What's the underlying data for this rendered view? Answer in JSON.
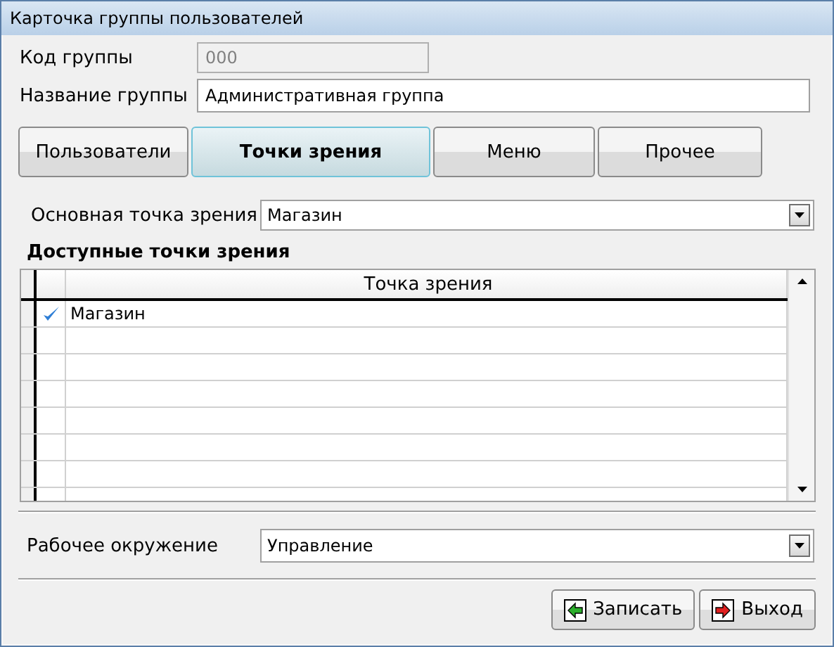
{
  "window": {
    "title": "Карточка группы пользователей"
  },
  "group_code": {
    "label": "Код группы",
    "value": "000",
    "disabled": true
  },
  "group_name": {
    "label": "Название группы",
    "value": "Административная группа"
  },
  "tabs": [
    {
      "label": "Пользователи",
      "selected": false
    },
    {
      "label": "Точки зрения",
      "selected": true
    },
    {
      "label": "Меню",
      "selected": false
    },
    {
      "label": "Прочее",
      "selected": false
    }
  ],
  "main_view": {
    "label": "Основная точка зрения",
    "value": "Магазин"
  },
  "available_views": {
    "title": "Доступные точки зрения",
    "columns": [
      "Точка зрения"
    ],
    "rows": [
      {
        "checked": true,
        "name": "Магазин"
      }
    ]
  },
  "environment": {
    "label": "Рабочее окружение",
    "value": "Управление"
  },
  "buttons": [
    {
      "label": "Записать",
      "kind": "save"
    },
    {
      "label": "Выход",
      "kind": "exit"
    }
  ]
}
